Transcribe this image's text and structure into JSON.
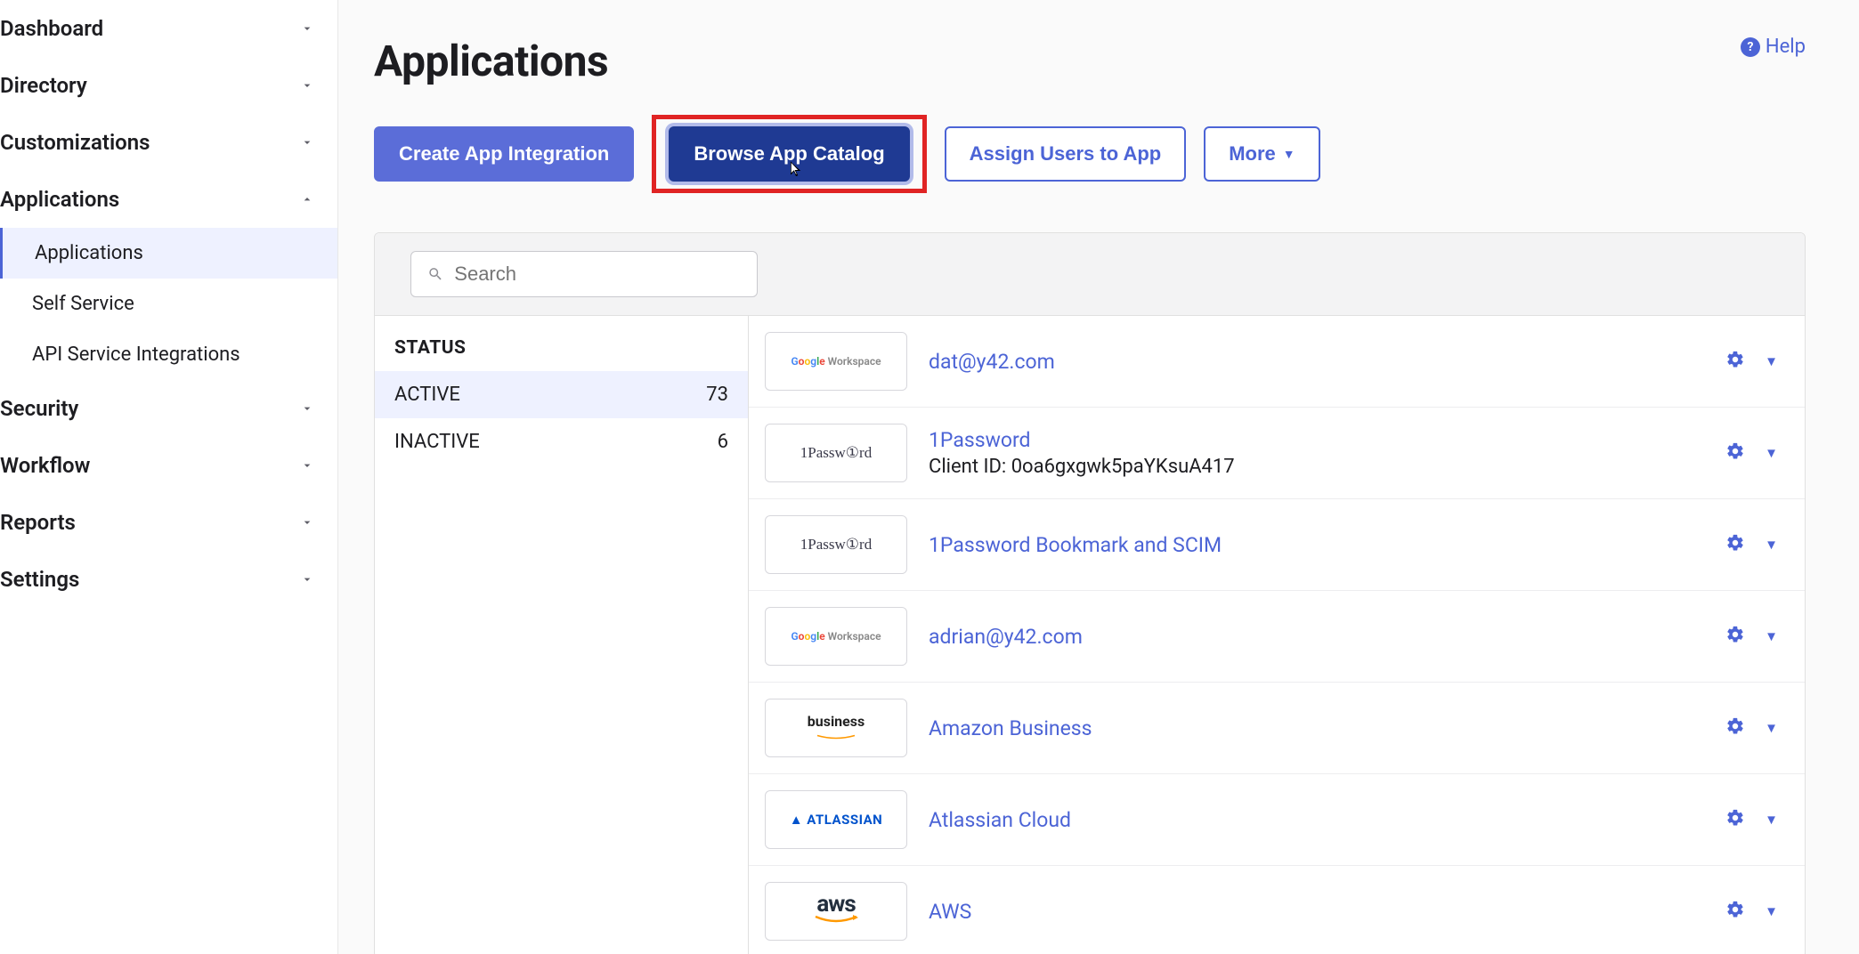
{
  "sidebar": {
    "items": [
      {
        "label": "Dashboard",
        "expanded": false
      },
      {
        "label": "Directory",
        "expanded": false
      },
      {
        "label": "Customizations",
        "expanded": false
      },
      {
        "label": "Applications",
        "expanded": true,
        "subs": [
          {
            "label": "Applications",
            "active": true
          },
          {
            "label": "Self Service"
          },
          {
            "label": "API Service Integrations"
          }
        ]
      },
      {
        "label": "Security",
        "expanded": false
      },
      {
        "label": "Workflow",
        "expanded": false
      },
      {
        "label": "Reports",
        "expanded": false
      },
      {
        "label": "Settings",
        "expanded": false
      }
    ]
  },
  "page": {
    "title": "Applications",
    "help": "Help"
  },
  "actions": {
    "create": "Create App Integration",
    "browse": "Browse App Catalog",
    "assign": "Assign Users to App",
    "more": "More"
  },
  "search": {
    "placeholder": "Search"
  },
  "status": {
    "title": "STATUS",
    "rows": [
      {
        "label": "ACTIVE",
        "count": "73",
        "active": true
      },
      {
        "label": "INACTIVE",
        "count": "6"
      }
    ]
  },
  "apps": [
    {
      "logo": "gw",
      "name": "dat@y42.com"
    },
    {
      "logo": "1p",
      "name": "1Password",
      "sub": "Client ID: 0oa6gxgwk5paYKsuA417"
    },
    {
      "logo": "1p",
      "name": "1Password Bookmark and SCIM"
    },
    {
      "logo": "gw",
      "name": "adrian@y42.com"
    },
    {
      "logo": "biz",
      "name": "Amazon Business"
    },
    {
      "logo": "atl",
      "name": "Atlassian Cloud"
    },
    {
      "logo": "aws",
      "name": "AWS"
    }
  ],
  "logos": {
    "gw_suffix": " Workspace",
    "onep": "1Passw①rd",
    "biz": "business",
    "atl": "▲ ATLASSIAN",
    "aws": "aws"
  }
}
